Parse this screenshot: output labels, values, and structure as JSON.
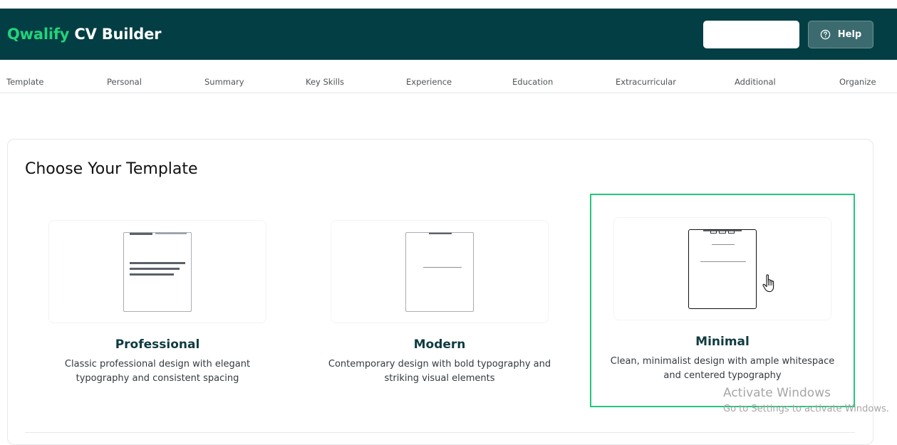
{
  "app": {
    "brand_accent": "Qwalify",
    "brand_main": " CV Builder",
    "colors": {
      "header_bg": "#033e45",
      "accent": "#22d47a",
      "selected_border": "#22c77a"
    }
  },
  "header": {
    "search_value": "",
    "help_label": "Help",
    "help_icon": "question-circle-icon"
  },
  "nav": {
    "items": [
      "Template",
      "Personal",
      "Summary",
      "Key Skills",
      "Experience",
      "Education",
      "Extracurricular",
      "Additional",
      "Organize"
    ]
  },
  "main": {
    "title": "Choose Your Template",
    "selected_template": "Minimal",
    "templates": [
      {
        "name": "Professional",
        "description_line1": "Classic professional design with elegant",
        "description_line2": "typography and consistent spacing"
      },
      {
        "name": "Modern",
        "description_line1": "Contemporary design with bold typography and",
        "description_line2": "striking visual elements"
      },
      {
        "name": "Minimal",
        "description_line1": "Clean, minimalist design with ample whitespace",
        "description_line2": "and centered typography"
      }
    ]
  },
  "watermark": {
    "line1": "Activate Windows",
    "line2": "Go to Settings to activate Windows."
  }
}
